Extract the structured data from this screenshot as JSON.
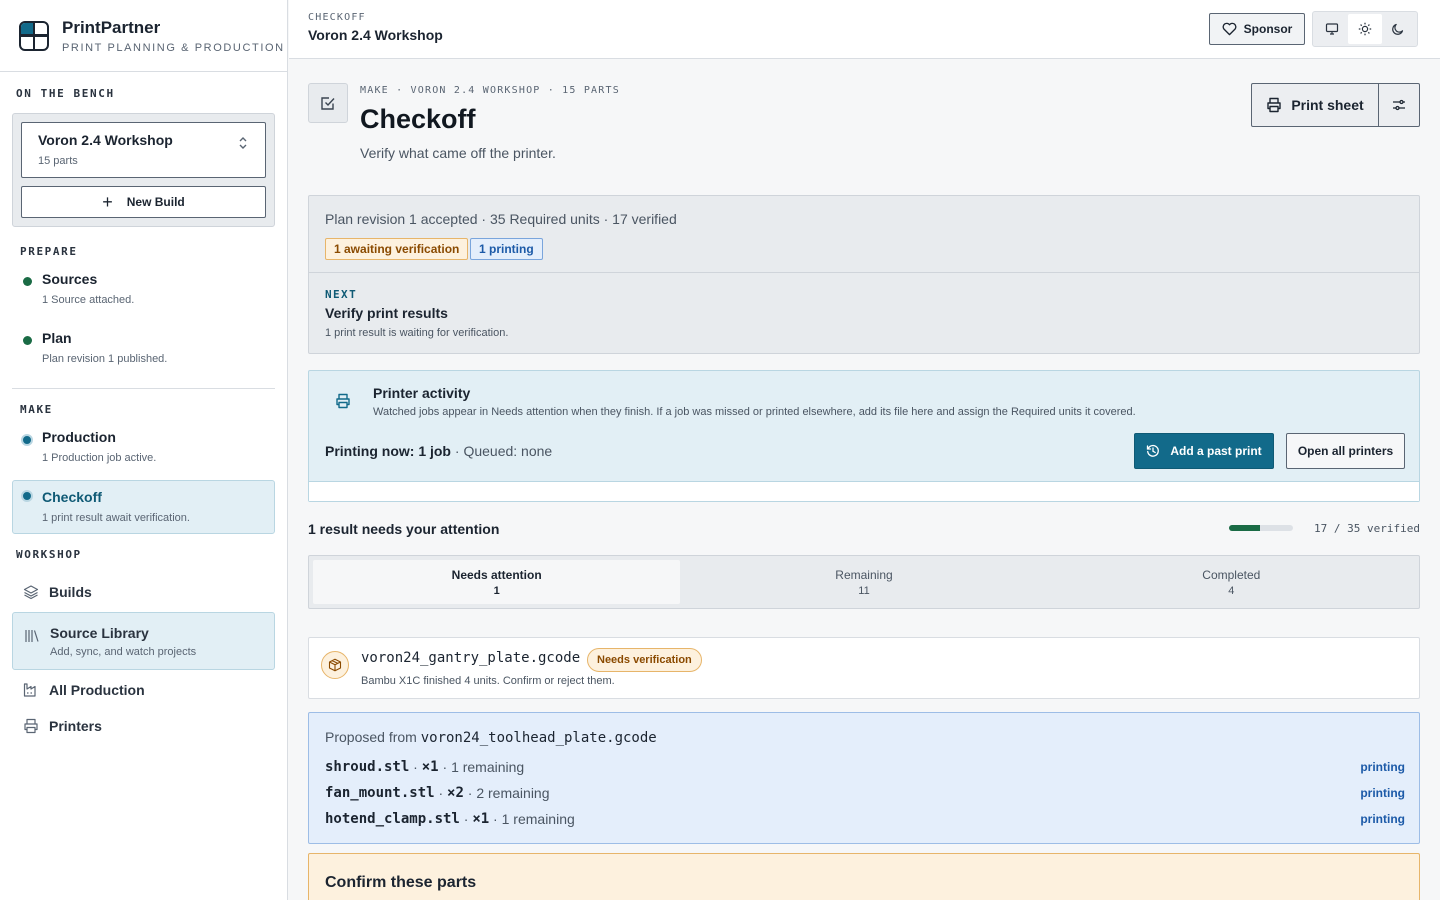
{
  "brand": {
    "name": "PrintPartner",
    "tagline": "PRINT PLANNING & PRODUCTION"
  },
  "sidebar": {
    "bench_label": "ON THE BENCH",
    "build": {
      "name": "Voron 2.4 Workshop",
      "parts": "15 parts"
    },
    "new_build_label": "New Build",
    "prepare_label": "PREPARE",
    "prepare": [
      {
        "title": "Sources",
        "subtitle": "1 Source attached."
      },
      {
        "title": "Plan",
        "subtitle": "Plan revision 1 published."
      }
    ],
    "make_label": "MAKE",
    "make": [
      {
        "title": "Production",
        "subtitle": "1 Production job active."
      },
      {
        "title": "Checkoff",
        "subtitle": "1 print result await verification."
      }
    ],
    "workshop_label": "WORKSHOP",
    "workshop": [
      {
        "title": "Builds"
      },
      {
        "title": "Source Library",
        "subtitle": "Add, sync, and watch projects"
      },
      {
        "title": "All Production"
      },
      {
        "title": "Printers"
      }
    ]
  },
  "topbar": {
    "crumb": "CHECKOFF",
    "title": "Voron 2.4 Workshop",
    "sponsor_label": "Sponsor"
  },
  "header": {
    "meta": "MAKE · VORON 2.4 WORKSHOP · 15 PARTS",
    "title": "Checkoff",
    "subtitle": "Verify what came off the printer.",
    "print_sheet_label": "Print sheet"
  },
  "plan": {
    "summary": "Plan revision 1 accepted · 35 Required units · 17 verified",
    "badge_awaiting": "1 awaiting verification",
    "badge_printing": "1 printing",
    "next_label": "NEXT",
    "next_title": "Verify print results",
    "next_subtitle": "1 print result is waiting for verification."
  },
  "printer_activity": {
    "title": "Printer activity",
    "description": "Watched jobs appear in Needs attention when they finish. If a job was missed or printed elsewhere, add its file here and assign the Required units it covered.",
    "now_label": "Printing now: 1 job",
    "queued": " · Queued: none",
    "add_past_label": "Add a past print",
    "open_printers_label": "Open all printers"
  },
  "attention": {
    "title": "1 result needs your attention",
    "verified_fraction": 0.486,
    "verified_text": "17 / 35 verified"
  },
  "tabs": [
    {
      "label": "Needs attention",
      "count": "1"
    },
    {
      "label": "Remaining",
      "count": "11"
    },
    {
      "label": "Completed",
      "count": "4"
    }
  ],
  "result": {
    "file": "voron24_gantry_plate.gcode",
    "badge": "Needs verification",
    "subtitle": "Bambu X1C finished 4 units. Confirm or reject them."
  },
  "proposed": {
    "prefix": "Proposed from ",
    "file": "voron24_toolhead_plate.gcode",
    "rows": [
      {
        "name": "shroud.stl",
        "qty": "×1",
        "remaining": "1 remaining",
        "status": "printing"
      },
      {
        "name": "fan_mount.stl",
        "qty": "×2",
        "remaining": "2 remaining",
        "status": "printing"
      },
      {
        "name": "hotend_clamp.stl",
        "qty": "×1",
        "remaining": "1 remaining",
        "status": "printing"
      }
    ]
  },
  "confirm": {
    "title": "Confirm these parts"
  },
  "colors": {
    "accent": "#126a8a",
    "success": "#1a6b45",
    "warning": "#e7b56a",
    "info": "#1c5aa8"
  }
}
